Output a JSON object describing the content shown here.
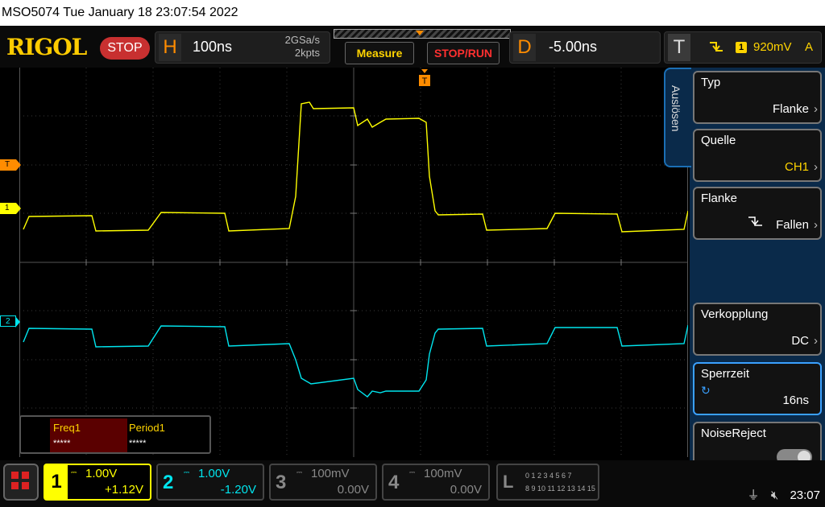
{
  "titlebar": {
    "text": "MSO5074  Tue January 18 23:07:54 2022"
  },
  "logo": "RIGOL",
  "run_state": "STOP",
  "horizontal": {
    "letter": "H",
    "timebase": "100ns",
    "sample_rate": "2GSa/s",
    "memory_depth": "2kpts"
  },
  "buttons": {
    "measure": "Measure",
    "stop_run": "STOP/RUN"
  },
  "delay": {
    "letter": "D",
    "value": "-5.00ns"
  },
  "trigger": {
    "letter": "T",
    "edge_icon": "falling-edge-icon",
    "source": "1",
    "level": "920mV",
    "mode": "A"
  },
  "markers": {
    "trigger": "T",
    "ch1": "1",
    "ch2": "2"
  },
  "measurements": [
    {
      "label": "Freq1",
      "value": "*****"
    },
    {
      "label": "Period1",
      "value": "*****"
    }
  ],
  "menu": {
    "tab": "Auslösen",
    "items": [
      {
        "label": "Typ",
        "value": "Flanke"
      },
      {
        "label": "Quelle",
        "value": "CH1"
      },
      {
        "label": "Flanke",
        "value": "Fallen"
      },
      {
        "label": "Verkopplung",
        "value": "DC"
      },
      {
        "label": "Sperrzeit",
        "value": "16ns"
      },
      {
        "label": "NoiseReject",
        "value": ""
      }
    ]
  },
  "channels": [
    {
      "num": "1",
      "scale": "1.00V",
      "offset": "+1.12V",
      "color": "#ffff00"
    },
    {
      "num": "2",
      "scale": "1.00V",
      "offset": "-1.20V",
      "color": "#00e5ee"
    },
    {
      "num": "3",
      "scale": "100mV",
      "offset": "0.00V",
      "color": "#888888"
    },
    {
      "num": "4",
      "scale": "100mV",
      "offset": "0.00V",
      "color": "#888888"
    }
  ],
  "logic": {
    "label": "L",
    "row1": "0 1 2 3  4 5 6 7",
    "row2": "8 9 10 11  12 13 14 15"
  },
  "status": {
    "usb_icon": "usb-icon",
    "sound_icon": "sound-muted-icon",
    "time": "23:07"
  }
}
